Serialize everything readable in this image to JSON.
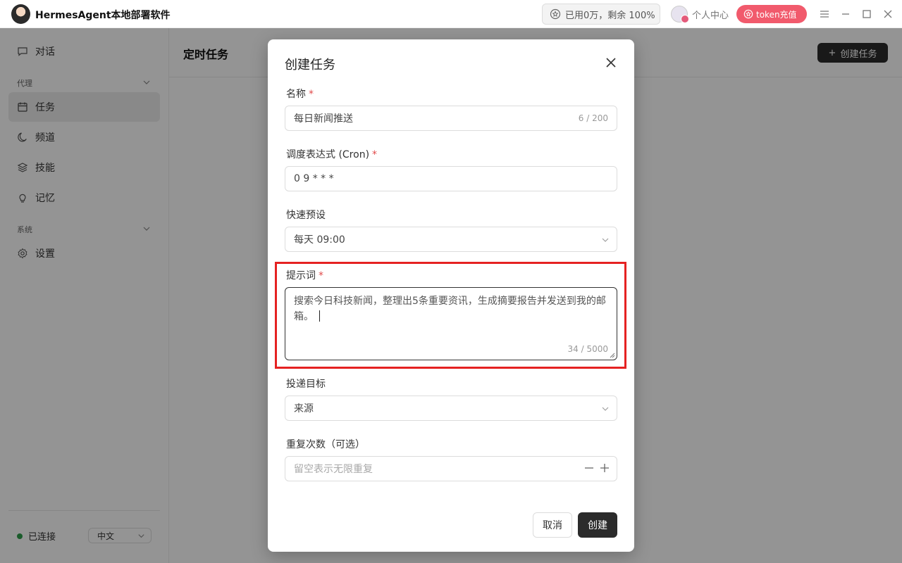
{
  "app": {
    "title": "HermesAgent本地部署软件",
    "usage": "已用0万，剩余 100%",
    "profile_label": "个人中心",
    "recharge_label": "token充值"
  },
  "sidebar": {
    "chat": "对话",
    "group_agent": "代理",
    "items": [
      {
        "label": "任务",
        "icon": "calendar-icon",
        "active": true
      },
      {
        "label": "频道",
        "icon": "moon-icon"
      },
      {
        "label": "技能",
        "icon": "layers-icon"
      },
      {
        "label": "记忆",
        "icon": "lightbulb-icon"
      }
    ],
    "group_system": "系统",
    "settings": "设置",
    "status": "已连接",
    "language": "中文"
  },
  "main": {
    "title": "定时任务",
    "create_button": "创建任务"
  },
  "modal": {
    "title": "创建任务",
    "name_label": "名称",
    "name_value": "每日新闻推送",
    "name_counter": "6 / 200",
    "cron_label": "调度表达式 (Cron)",
    "cron_value": "0 9 * * *",
    "preset_label": "快速预设",
    "preset_value": "每天 09:00",
    "prompt_label": "提示词",
    "prompt_value": "搜索今日科技新闻，整理出5条重要资讯，生成摘要报告并发送到我的邮箱。",
    "prompt_counter": "34 / 5000",
    "delivery_label": "投递目标",
    "delivery_value": "来源",
    "repeat_label": "重复次数（可选）",
    "repeat_placeholder": "留空表示无限重复",
    "cancel": "取消",
    "create": "创建"
  },
  "colors": {
    "accent": "#2b2b2b",
    "recharge": "#f15a6c",
    "required": "#e14b4b",
    "highlight": "#e52222",
    "connected": "#2e9d4a"
  }
}
